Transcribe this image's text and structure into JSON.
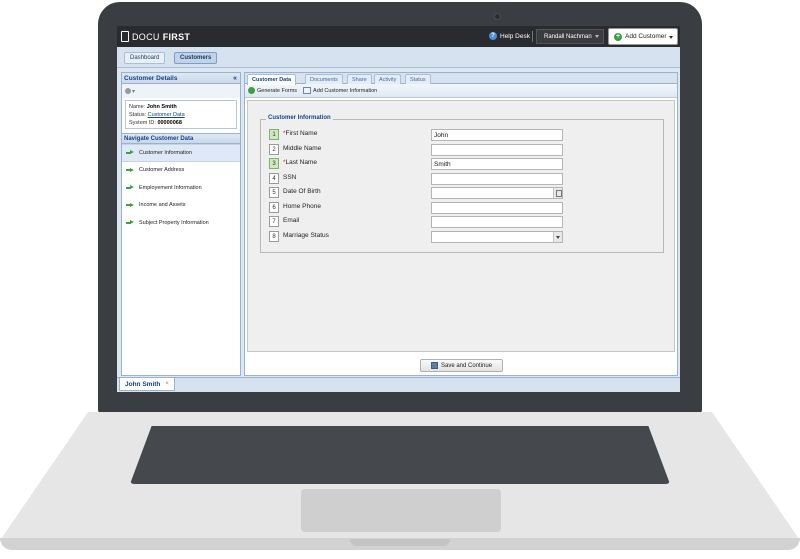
{
  "app": {
    "logo_prefix": "DOCU",
    "logo_suffix": "FIRST"
  },
  "header": {
    "help_label": "Help Desk",
    "user_name": "Randall Nachman",
    "add_customer_label": "Add Customer"
  },
  "nav": {
    "dashboard_label": "Dashboard",
    "customers_label": "Customers"
  },
  "customer_details": {
    "title": "Customer Details",
    "name_label": "Name:",
    "name_value": "John Smith",
    "status_label": "Status:",
    "status_value": "Customer Data",
    "system_id_label": "System ID:",
    "system_id_value": "00000068"
  },
  "navigate": {
    "title": "Navigate Customer Data",
    "items": [
      {
        "label": "Customer Information"
      },
      {
        "label": "Customer Address"
      },
      {
        "label": "Employement Information"
      },
      {
        "label": "Income and Assets"
      },
      {
        "label": "Subject Property Information"
      }
    ]
  },
  "tabs": [
    {
      "label": "Customer Data"
    },
    {
      "label": "Documents"
    },
    {
      "label": "Share"
    },
    {
      "label": "Activity"
    },
    {
      "label": "Status"
    }
  ],
  "toolbar": {
    "generate_label": "Generate Forms",
    "add_info_label": "Add Customer Information"
  },
  "form": {
    "legend": "Customer Information",
    "required_mark": "*",
    "fields": [
      {
        "num": "1",
        "label": "First Name",
        "value": ""
      },
      {
        "num": "2",
        "label": "Middle Name",
        "value": ""
      },
      {
        "num": "3",
        "label": "Last Name",
        "value": ""
      },
      {
        "num": "4",
        "label": "SSN",
        "value": ""
      },
      {
        "num": "5",
        "label": "Date Of Birth",
        "value": ""
      },
      {
        "num": "6",
        "label": "Home Phone",
        "value": ""
      },
      {
        "num": "7",
        "label": "Email",
        "value": ""
      },
      {
        "num": "8",
        "label": "Marriage Status",
        "value": ""
      }
    ],
    "first_name_value": "John",
    "last_name_value": "Smith",
    "save_label": "Save and Continue"
  },
  "bottom_tab": {
    "label": "John Smith",
    "close_glyph": "×"
  }
}
